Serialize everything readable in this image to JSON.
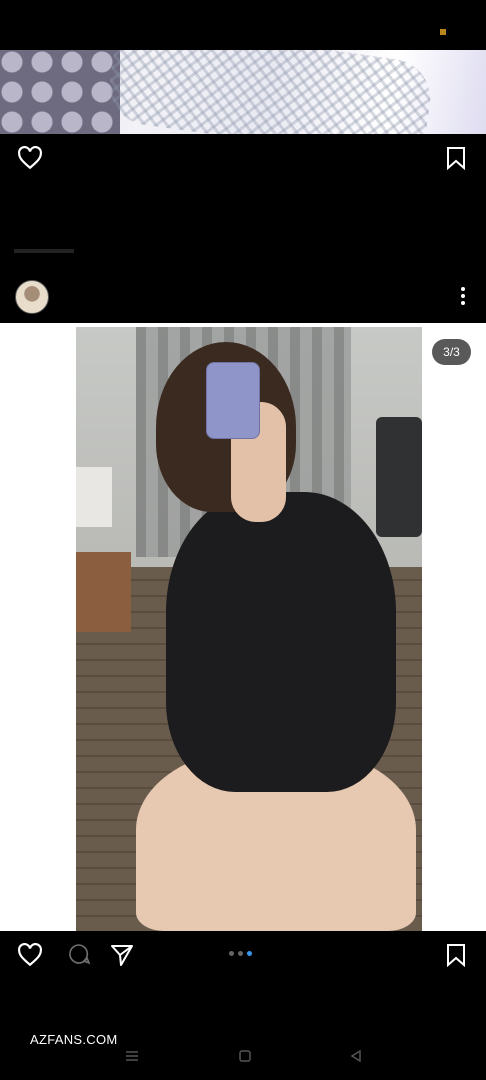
{
  "post_top": {
    "like_icon": "heart-outline-icon",
    "save_icon": "bookmark-outline-icon",
    "more_icon": "more-vertical-icon"
  },
  "post_main": {
    "slide_counter": "3/3",
    "carousel": {
      "total": 3,
      "active_index": 2
    },
    "like_icon": "heart-outline-icon",
    "comment_icon": "comment-icon",
    "share_icon": "send-icon",
    "save_icon": "bookmark-outline-icon"
  },
  "watermark": "AZFANS.COM",
  "nav": {
    "recents_icon": "recents-icon",
    "home_icon": "home-square-icon",
    "back_icon": "back-triangle-icon"
  },
  "colors": {
    "background": "#000000",
    "carousel_active": "#3897f0",
    "carousel_inactive": "#666666",
    "badge_bg": "#3c3c3c"
  }
}
